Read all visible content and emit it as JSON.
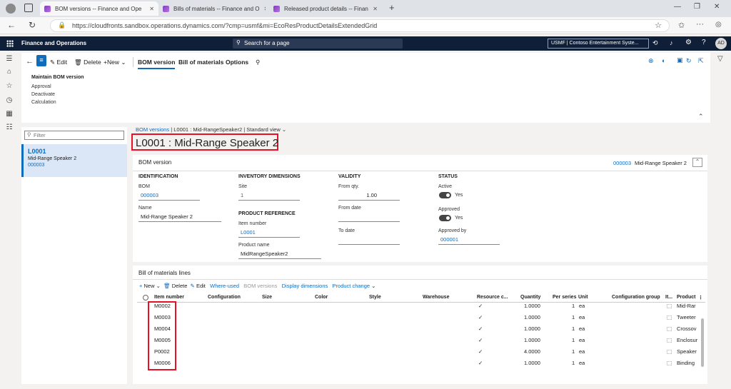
{
  "browser": {
    "tabs": [
      {
        "title": "BOM versions -- Finance and Ope",
        "active": true
      },
      {
        "title": "Bills of materials -- Finance and O",
        "active": false
      },
      {
        "title": "Released product details -- Finan",
        "active": false
      }
    ],
    "url": "https://cloudfronts.sandbox.operations.dynamics.com/?cmp=usmf&mi=EcoResProductDetailsExtendedGrid"
  },
  "app": {
    "title": "Finance and Operations",
    "search_placeholder": "Search for a page",
    "company": "USMF | Contoso Entertainment Syste...",
    "avatar": "AD"
  },
  "actionpane": {
    "edit": "Edit",
    "delete": "Delete",
    "new": "New",
    "tabs": [
      "BOM version",
      "Bill of materials",
      "Options"
    ],
    "group_title": "Maintain BOM version",
    "group_items": [
      "Approval",
      "Deactivate",
      "Calculation"
    ]
  },
  "listpane": {
    "filter_placeholder": "Filter",
    "item": {
      "title": "L0001",
      "subtitle": "Mid-Range Speaker 2",
      "code": "000003"
    }
  },
  "breadcrumb": {
    "root": "BOM versions",
    "record": "L0001 : Mid-RangeSpeaker2",
    "view": "Standard view"
  },
  "page_title": "L0001 : Mid-Range Speaker 2",
  "bom_version": {
    "header": "BOM version",
    "summary_code": "000003",
    "summary_name": "Mid-Range Speaker 2",
    "identification": {
      "caption": "IDENTIFICATION",
      "bom_label": "BOM",
      "bom": "000003",
      "name_label": "Name",
      "name": "Mid-Range Speaker 2"
    },
    "inventory": {
      "caption": "INVENTORY DIMENSIONS",
      "site_label": "Site",
      "site": "1"
    },
    "product": {
      "caption": "PRODUCT REFERENCE",
      "item_label": "Item number",
      "item": "L0001",
      "pname_label": "Product name",
      "pname": "MidRangeSpeaker2"
    },
    "validity": {
      "caption": "VALIDITY",
      "from_qty_label": "From qty.",
      "from_qty": "1.00",
      "from_date_label": "From date",
      "to_date_label": "To date"
    },
    "status": {
      "caption": "STATUS",
      "active_label": "Active",
      "active": "Yes",
      "approved_label": "Approved",
      "approved": "Yes",
      "approved_by_label": "Approved by",
      "approved_by": "000001"
    }
  },
  "bom_lines": {
    "header": "Bill of materials lines",
    "toolbar": {
      "new": "New",
      "delete": "Delete",
      "edit": "Edit",
      "where_used": "Where-used",
      "bom_versions": "BOM versions",
      "display_dimensions": "Display dimensions",
      "product_change": "Product change"
    },
    "columns": [
      "Item number",
      "Configuration",
      "Size",
      "Color",
      "Style",
      "Warehouse",
      "Resource c...",
      "Quantity",
      "Per series",
      "Unit",
      "Configuration group",
      "It...",
      "Product"
    ],
    "rows": [
      {
        "item": "M0002",
        "quantity": "1.0000",
        "per_series": "1",
        "unit": "ea",
        "product": "Mid-Rar"
      },
      {
        "item": "M0003",
        "quantity": "1.0000",
        "per_series": "1",
        "unit": "ea",
        "product": "Tweeter"
      },
      {
        "item": "M0004",
        "quantity": "1.0000",
        "per_series": "1",
        "unit": "ea",
        "product": "Crossov"
      },
      {
        "item": "M0005",
        "quantity": "1.0000",
        "per_series": "1",
        "unit": "ea",
        "product": "Enclosur"
      },
      {
        "item": "P0002",
        "quantity": "4.0000",
        "per_series": "1",
        "unit": "ea",
        "product": "Speaker"
      },
      {
        "item": "M0006",
        "quantity": "1.0000",
        "per_series": "1",
        "unit": "ea",
        "product": "Binding"
      }
    ]
  }
}
